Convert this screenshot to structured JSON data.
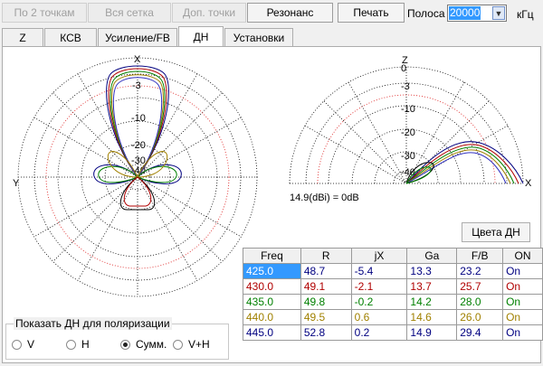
{
  "toolbar": {
    "btn_two_points": "По 2 точкам",
    "btn_whole_grid": "Вся сетка",
    "btn_extra_points": "Доп. точки",
    "btn_resonance": "Резонанс",
    "btn_print": "Печать",
    "band_label": "Полоса",
    "band_value": "20000",
    "band_unit": "кГц"
  },
  "tabs": [
    "Z",
    "КСВ",
    "Усиление/FB",
    "ДН",
    "Установки"
  ],
  "active_tab": "ДН",
  "plots": {
    "azimuth": {
      "top_label": "X",
      "left_label": "Y",
      "rings": [
        "-3",
        "-10",
        "-20",
        "-30",
        "-40"
      ]
    },
    "elevation": {
      "top_label": "Z",
      "right_label": "X",
      "rings": [
        "0",
        "-3",
        "-10",
        "-20",
        "-30",
        "-40"
      ],
      "ref_text": "14.9(dBi) = 0dB"
    }
  },
  "colors_button": "Цвета ДН",
  "table": {
    "headers": [
      "Freq",
      "R",
      "jX",
      "Ga",
      "F/B",
      "ON"
    ],
    "rows": [
      {
        "color": "#000080",
        "cells": [
          "425.0",
          "48.7",
          "-5.4",
          "13.3",
          "23.2",
          "On"
        ]
      },
      {
        "color": "#b00000",
        "cells": [
          "430.0",
          "49.1",
          "-2.1",
          "13.7",
          "25.7",
          "On"
        ]
      },
      {
        "color": "#008000",
        "cells": [
          "435.0",
          "49.8",
          "-0.2",
          "14.2",
          "28.0",
          "On"
        ]
      },
      {
        "color": "#a08000",
        "cells": [
          "440.0",
          "49.5",
          "0.6",
          "14.6",
          "26.0",
          "On"
        ]
      },
      {
        "color": "#000080",
        "cells": [
          "445.0",
          "52.8",
          "0.2",
          "14.9",
          "29.4",
          "On"
        ]
      }
    ]
  },
  "polarization": {
    "title": "Показать ДН для поляризации",
    "options": [
      "V",
      "H",
      "Сумм.",
      "V+H"
    ],
    "selected": "Сумм."
  }
}
